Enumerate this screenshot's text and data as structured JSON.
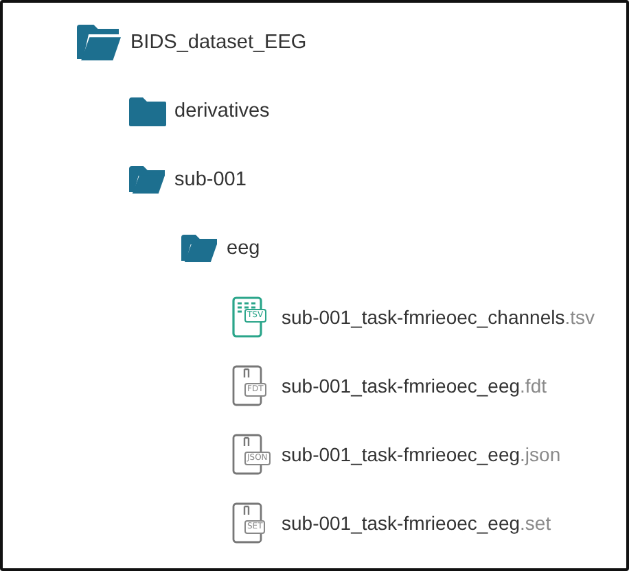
{
  "tree": [
    {
      "kind": "folder",
      "name": "BIDS_dataset_EEG",
      "expanded": true,
      "children": [
        {
          "kind": "folder",
          "name": "derivatives",
          "expanded": false
        },
        {
          "kind": "folder",
          "name": "sub-001",
          "expanded": true,
          "children": [
            {
              "kind": "folder",
              "name": "eeg",
              "expanded": true,
              "children": [
                {
                  "kind": "table-file",
                  "name": "sub-001_task-fmrieoec_channels",
                  "extension": ".tsv",
                  "badge": "TSV"
                },
                {
                  "kind": "file",
                  "name": "sub-001_task-fmrieoec_eeg",
                  "extension": ".fdt",
                  "badge": "FDT"
                },
                {
                  "kind": "file",
                  "name": "sub-001_task-fmrieoec_eeg",
                  "extension": ".json",
                  "badge": "JSON"
                },
                {
                  "kind": "file",
                  "name": "sub-001_task-fmrieoec_eeg",
                  "extension": ".set",
                  "badge": "SET"
                }
              ]
            }
          ]
        }
      ]
    }
  ]
}
